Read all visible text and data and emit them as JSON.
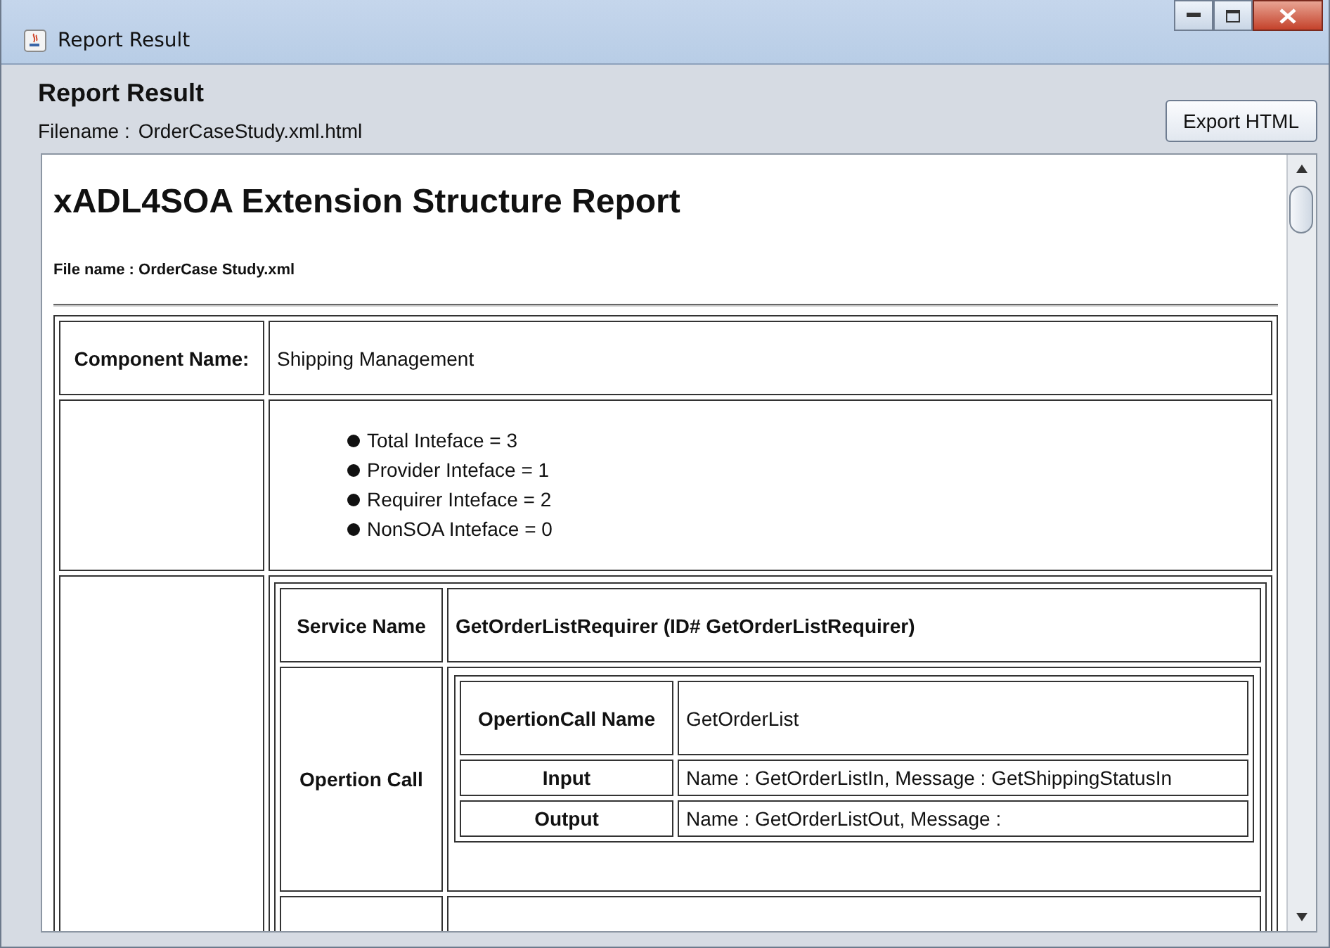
{
  "window": {
    "title": "Report Result"
  },
  "header": {
    "title": "Report Result",
    "filename_label": "Filename :",
    "filename": "OrderCaseStudy.xml.html",
    "export_button": "Export HTML"
  },
  "report": {
    "heading": "xADL4SOA Extension Structure Report",
    "file_name": "File name : OrderCase Study.xml",
    "component": {
      "label": "Component Name:",
      "value": "Shipping Management"
    },
    "interface_counts": [
      "Total Inteface = 3",
      "Provider Inteface = 1",
      "Requirer Inteface = 2",
      "NonSOA Inteface = 0"
    ],
    "service": {
      "label": "Service Name",
      "value": "GetOrderListRequirer (ID# GetOrderListRequirer)",
      "operation_label": "Opertion Call",
      "operation_rows": [
        {
          "label": "OpertionCall Name",
          "value": "GetOrderList"
        },
        {
          "label": "Input",
          "value": "Name : GetOrderListIn, Message : GetShippingStatusIn"
        },
        {
          "label": "Output",
          "value": "Name : GetOrderListOut, Message :"
        }
      ]
    }
  }
}
